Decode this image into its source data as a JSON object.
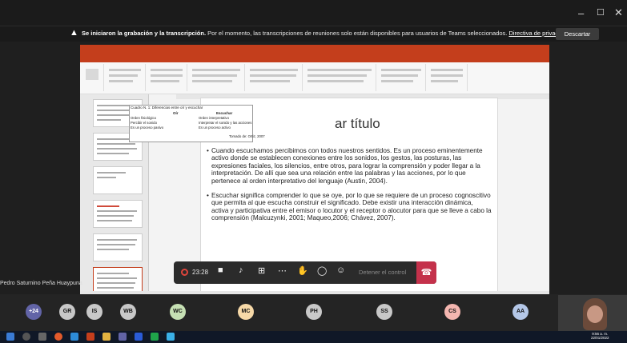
{
  "window": {
    "minimize": "–",
    "maximize": "☐",
    "close": "✕"
  },
  "banner": {
    "text_bold": "Se iniciaron la grabación y la transcripción.",
    "text_rest": " Por el momento, las transcripciones de reuniones solo están disponibles para usuarios de Teams seleccionados. ",
    "link": "Directiva de privacidad",
    "dismiss": "Descartar"
  },
  "slide": {
    "table_caption": "Cuadro N. 1: Diferencias entre oír y escuchar",
    "headers": [
      "Oír",
      "Escuchar"
    ],
    "rows": [
      [
        "Orden fisiológico",
        "Orden interpretativo"
      ],
      [
        "Percibir el sonido",
        "Interpretar el sonido y las acciones"
      ],
      [
        "Es un proceso pasivo",
        "Es un proceso activo"
      ]
    ],
    "table_source": "Tomado de: Ortiz, 2007",
    "title_partial": "ar título",
    "bullets": [
      "Cuando escuchamos percibimos con todos nuestros sentidos. Es un proceso eminentemente activo donde se establecen conexiones entre los sonidos, los gestos, las posturas, las expresiones faciales, los silencios, entre otros, para lograr la comprensión y poder llegar a la interpretación. De allí que sea una relación entre las palabras y las acciones, por lo que pertenece al orden interpretativo del lenguaje (Austin, 2004).",
      "Escuchar significa comprender lo que se oye, por lo que se requiere de un proceso cognoscitivo que permita al que escucha construir el significado. Debe existir una interacción dinámica, activa y participativa entre el emisor o locutor y el receptor o alocutor para que se lleve a cabo la comprensión (Malcuzynki, 2001; Maqueo,2006; Chávez, 2007)."
    ]
  },
  "meeting": {
    "rec_time": "23:28",
    "stop_share": "Detener el control",
    "presenter": "Pedro Saturnino Peña Huaypuna"
  },
  "participants": [
    {
      "initials": "+24",
      "color": "#6264a7"
    },
    {
      "initials": "GR",
      "color": "#c8c8c8"
    },
    {
      "initials": "IS",
      "color": "#c8c8c8"
    },
    {
      "initials": "WB",
      "color": "#c8c8c8"
    },
    {
      "initials": "WC",
      "color": "#c6e0b4"
    },
    {
      "initials": "MC",
      "color": "#f7d9a8"
    },
    {
      "initials": "PH",
      "color": "#c8c8c8"
    },
    {
      "initials": "SS",
      "color": "#c8c8c8"
    },
    {
      "initials": "CS",
      "color": "#f4b6b0"
    },
    {
      "initials": "AA",
      "color": "#b4c7e7"
    }
  ],
  "taskbar": {
    "time": "9:56 a. m.",
    "date": "22/01/2022"
  }
}
